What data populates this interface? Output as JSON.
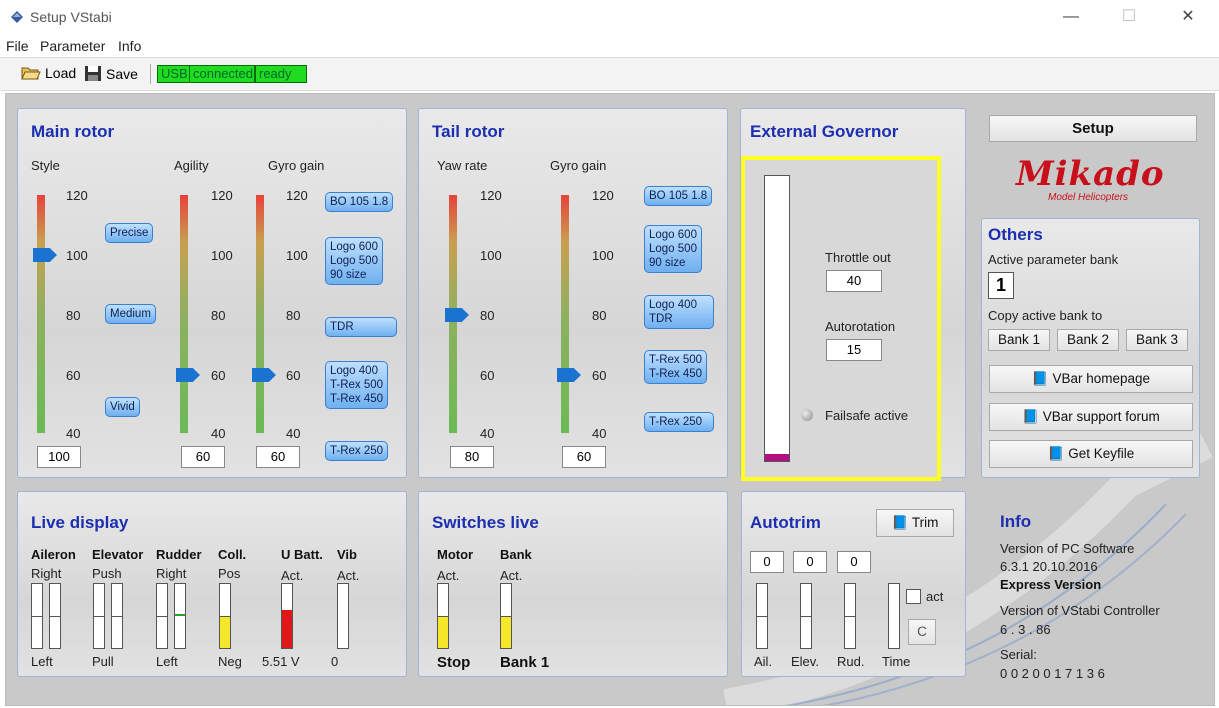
{
  "window": {
    "title": "Setup VStabi",
    "minimize": "—",
    "maximize": "☐",
    "close": "✕"
  },
  "menu": [
    "File",
    "Parameter",
    "Info"
  ],
  "toolbar": {
    "load": "Load",
    "save": "Save",
    "usb": "USB",
    "connected": "connected",
    "ready": "ready"
  },
  "main_rotor": {
    "title": "Main rotor",
    "style_label": "Style",
    "agility_label": "Agility",
    "gyro_label": "Gyro gain",
    "ticks": [
      "120",
      "100",
      "80",
      "60",
      "40"
    ],
    "style_value": "100",
    "agility_value": "60",
    "gyro_value": "60",
    "style_bubbles": [
      "Precise",
      "Medium",
      "Vivid"
    ],
    "gyro_bubbles": [
      "BO 105 1.8",
      "Logo 600\nLogo 500\n90 size",
      "TDR",
      "Logo 400\nT-Rex 500\nT-Rex 450",
      "T-Rex 250"
    ]
  },
  "tail_rotor": {
    "title": "Tail rotor",
    "yaw_label": "Yaw rate",
    "gyro_label": "Gyro gain",
    "ticks": [
      "120",
      "100",
      "80",
      "60",
      "40"
    ],
    "yaw_value": "80",
    "gyro_value": "60",
    "gyro_bubbles": [
      "BO 105 1.8",
      "Logo 600\nLogo 500\n90 size",
      "Logo 400\nTDR",
      "T-Rex 500\nT-Rex 450",
      "T-Rex 250"
    ]
  },
  "governor": {
    "title": "External Governor",
    "throttle_label": "Throttle out",
    "throttle_value": "40",
    "autorot_label": "Autorotation",
    "autorot_value": "15",
    "failsafe": "Failsafe active"
  },
  "setup": {
    "button": "Setup",
    "logo": "Mikado",
    "logo_sub": "Model Helicopters"
  },
  "others": {
    "title": "Others",
    "bank_label": "Active parameter bank",
    "bank_value": "1",
    "copy_label": "Copy active bank to",
    "banks": [
      "Bank 1",
      "Bank 2",
      "Bank 3"
    ],
    "homepage": "VBar homepage",
    "forum": "VBar support forum",
    "keyfile": "Get Keyfile"
  },
  "live": {
    "title": "Live display",
    "cols": [
      {
        "h": "Aileron",
        "top": "Right",
        "bottom": "Left"
      },
      {
        "h": "Elevator",
        "top": "Push",
        "bottom": "Pull"
      },
      {
        "h": "Rudder",
        "top": "Right",
        "bottom": "Left"
      },
      {
        "h": "Coll.",
        "top": "Pos",
        "bottom": "Neg"
      },
      {
        "h": "U Batt.",
        "top": "Act.",
        "bottom": "5.51 V"
      },
      {
        "h": "Vib",
        "top": "Act.",
        "bottom": "0"
      }
    ]
  },
  "switches": {
    "title": "Switches live",
    "motor_h": "Motor",
    "motor_top": "Act.",
    "motor_state": "Stop",
    "bank_h": "Bank",
    "bank_top": "Act.",
    "bank_state": "Bank 1"
  },
  "autotrim": {
    "title": "Autotrim",
    "trim": "Trim",
    "values": [
      "0",
      "0",
      "0"
    ],
    "act": "act",
    "c": "C",
    "labels": [
      "Ail.",
      "Elev.",
      "Rud.",
      "Time"
    ]
  },
  "info": {
    "title": "Info",
    "pc_label": "Version of PC Software",
    "pc_version": "6.3.1  20.10.2016",
    "edition": "Express Version",
    "ctrl_label": "Version of VStabi Controller",
    "ctrl_version": "6 . 3 . 86",
    "serial_label": "Serial:",
    "serial": "0 0 2 0 0 1 7 1 3 6"
  },
  "colors": {
    "accent": "#1c2fb0",
    "status_green": "#1fdc1f",
    "highlight": "#ffff22"
  }
}
